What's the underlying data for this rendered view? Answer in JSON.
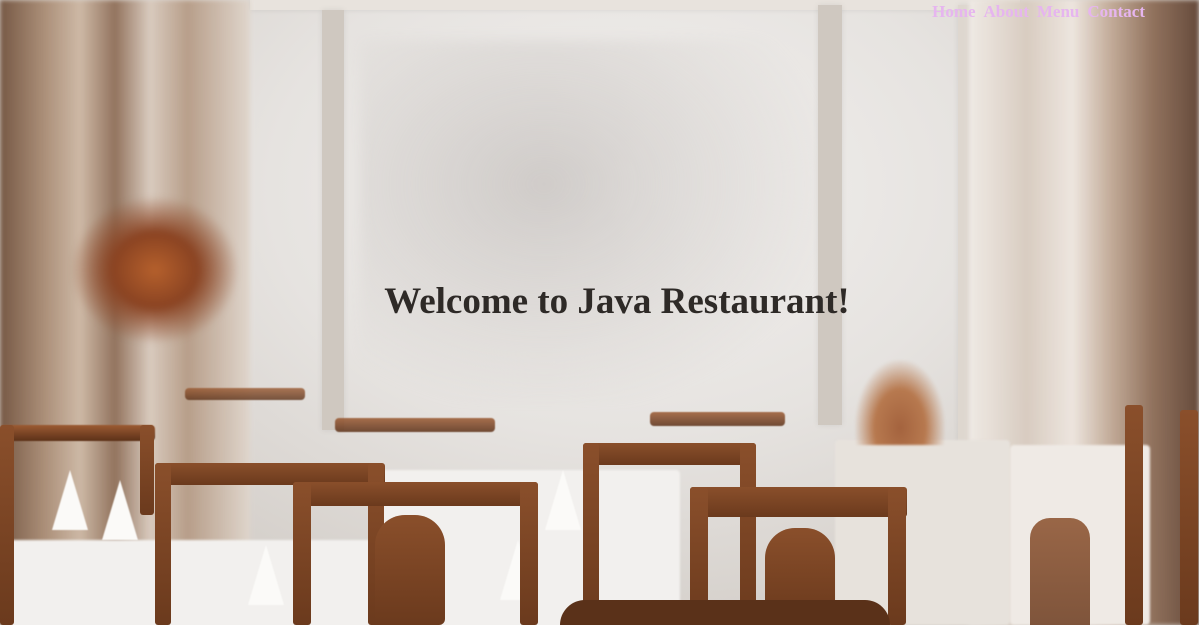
{
  "nav": {
    "items": [
      {
        "label": "Home"
      },
      {
        "label": "About"
      },
      {
        "label": "Menu"
      },
      {
        "label": "Contact"
      }
    ],
    "link_color": "#e6b5ef"
  },
  "hero": {
    "heading": "Welcome to Java Restaurant!",
    "heading_color": "#2e2a27",
    "background_description_icon": "restaurant-interior-photo"
  }
}
